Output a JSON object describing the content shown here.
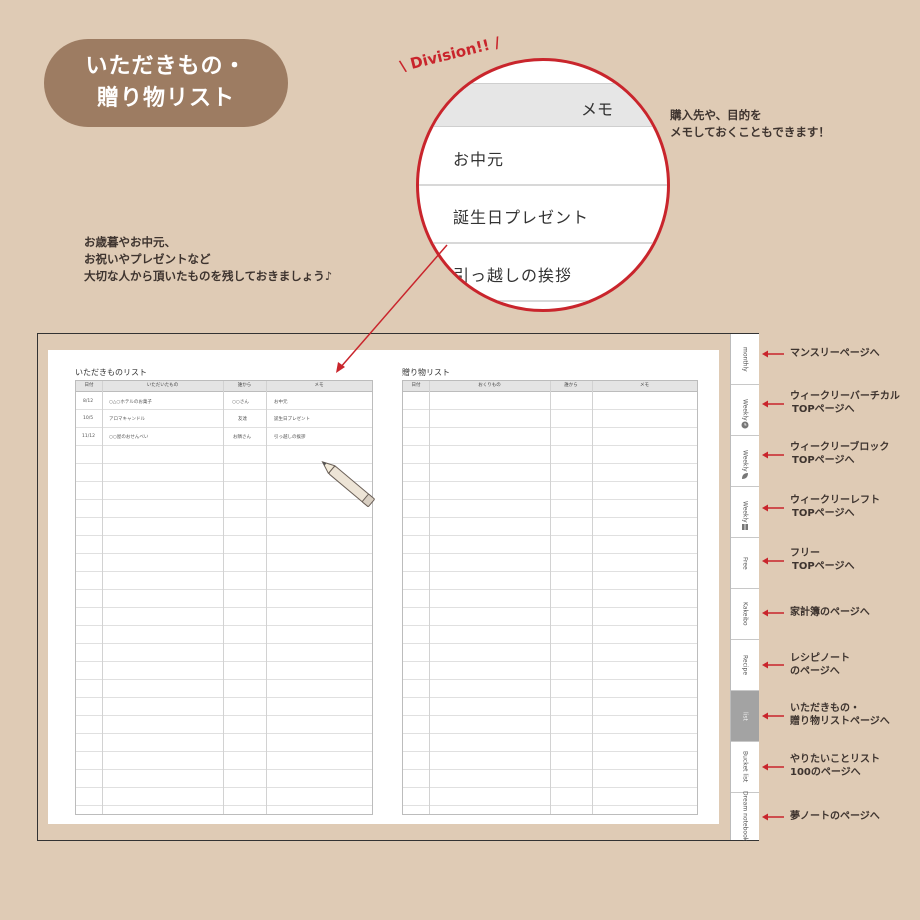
{
  "title": {
    "line1": "いただきもの・",
    "line2": "贈り物リスト"
  },
  "notes": {
    "left": [
      "お歳暮やお中元、",
      "お祝いやプレゼントなど",
      "大切な人から頂いたものを残しておきましょう♪"
    ],
    "right": [
      "購入先や、目的を",
      "メモしておくこともできます！"
    ]
  },
  "division_label": "\\ Division!! /",
  "zoom": {
    "header": "メモ",
    "rows": [
      "お中元",
      "誕生日プレゼント",
      "引っ越しの挨拶"
    ]
  },
  "left_page": {
    "title": "いただきものリスト",
    "headers": [
      "日付",
      "いただいたもの",
      "誰から",
      "メモ"
    ],
    "rows": [
      [
        "8/12",
        "○△○ホテルのお菓子",
        "○○さん",
        "お中元"
      ],
      [
        "10/5",
        "アロマキャンドル",
        "友達",
        "誕生日プレゼント"
      ],
      [
        "11/12",
        "○○屋のおせんべい",
        "お隣さん",
        "引っ越しの挨拶"
      ]
    ]
  },
  "right_page": {
    "title": "贈り物リスト",
    "headers": [
      "日付",
      "おくりもの",
      "誰から",
      "メモ"
    ]
  },
  "tabs": [
    {
      "label": "monthly",
      "icon": ""
    },
    {
      "label": "Weekly",
      "icon": "clock-icon"
    },
    {
      "label": "Weekly",
      "icon": "leaf-icon"
    },
    {
      "label": "Weekly",
      "icon": "book-icon"
    },
    {
      "label": "Free",
      "icon": ""
    },
    {
      "label": "Kakeibo",
      "icon": ""
    },
    {
      "label": "Recipe",
      "icon": ""
    },
    {
      "label": "list",
      "icon": "",
      "active": true
    },
    {
      "label": "Bucket list",
      "icon": ""
    },
    {
      "label": "Dream notebook",
      "icon": ""
    }
  ],
  "tab_labels": [
    [
      "マンスリーページへ"
    ],
    [
      "ウィークリーバーチカル",
      "TOPページへ"
    ],
    [
      "ウィークリーブロック",
      "TOPページへ"
    ],
    [
      "ウィークリーレフト",
      "TOPページへ"
    ],
    [
      "フリー",
      "TOPページへ"
    ],
    [
      "家計簿のページへ"
    ],
    [
      "レシピノート",
      "のページへ"
    ],
    [
      "いただきもの・",
      "贈り物リストページへ"
    ],
    [
      "やりたいことリスト",
      "100のページへ"
    ],
    [
      "夢ノートのページへ"
    ]
  ],
  "colors": {
    "background": "#dfcbb5",
    "pill": "#9d7c62",
    "accent_red": "#c9252c",
    "active_tab": "#a3a3a3"
  }
}
